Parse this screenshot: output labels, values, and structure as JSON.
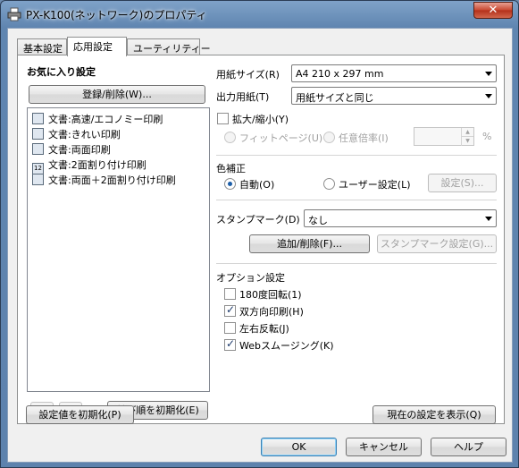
{
  "window": {
    "title": "PX-K100(ネットワーク)のプロパティ",
    "close_glyph": "✕"
  },
  "tabs": [
    {
      "label": "基本設定"
    },
    {
      "label": "応用設定"
    },
    {
      "label": "ユーティリティー"
    }
  ],
  "favorites": {
    "heading": "お気に入り設定",
    "register_button": "登録/削除(W)...",
    "items": [
      {
        "label": "文書:高速/エコノミー印刷",
        "icon": "document-icon"
      },
      {
        "label": "文書:きれい印刷",
        "icon": "document-icon"
      },
      {
        "label": "文書:両面印刷",
        "icon": "duplex-document-icon"
      },
      {
        "label": "文書:2面割り付け印刷",
        "icon": "two-up-icon"
      },
      {
        "label": "文書:両面＋2面割り付け印刷",
        "icon": "duplex-two-up-icon"
      }
    ],
    "up_glyph": "▲",
    "down_glyph": "▼",
    "reset_order_button": "並び順を初期化(E)"
  },
  "paper": {
    "size_label": "用紙サイズ(R)",
    "size_value": "A4 210 x 297 mm",
    "output_label": "出力用紙(T)",
    "output_value": "用紙サイズと同じ"
  },
  "scale": {
    "checkbox_label": "拡大/縮小(Y)",
    "checked": false,
    "fit_page_label": "フィットページ(U)",
    "custom_ratio_label": "任意倍率(I)",
    "unit": "%",
    "value": ""
  },
  "color": {
    "heading": "色補正",
    "auto_label": "自動(O)",
    "user_label": "ユーザー設定(L)",
    "selected": "auto",
    "settings_button": "設定(S)..."
  },
  "stamp": {
    "label": "スタンプマーク(D)",
    "value": "なし",
    "add_delete_button": "追加/削除(F)...",
    "settings_button": "スタンプマーク設定(G)..."
  },
  "options": {
    "heading": "オプション設定",
    "items": [
      {
        "label": "180度回転(1)",
        "checked": false
      },
      {
        "label": "双方向印刷(H)",
        "checked": true
      },
      {
        "label": "左右反転(J)",
        "checked": false
      },
      {
        "label": "Webスムージング(K)",
        "checked": true
      }
    ]
  },
  "footer": {
    "reset_defaults_button": "設定値を初期化(P)",
    "show_settings_button": "現在の設定を表示(Q)",
    "ok_button": "OK",
    "cancel_button": "キャンセル",
    "help_button": "ヘルプ"
  },
  "colors": {
    "titlebar": "#6f93bd",
    "dialog_bg": "#f0f0f0",
    "radio_selected": "#1c5ea8",
    "default_button_border": "#3c7fb1"
  }
}
